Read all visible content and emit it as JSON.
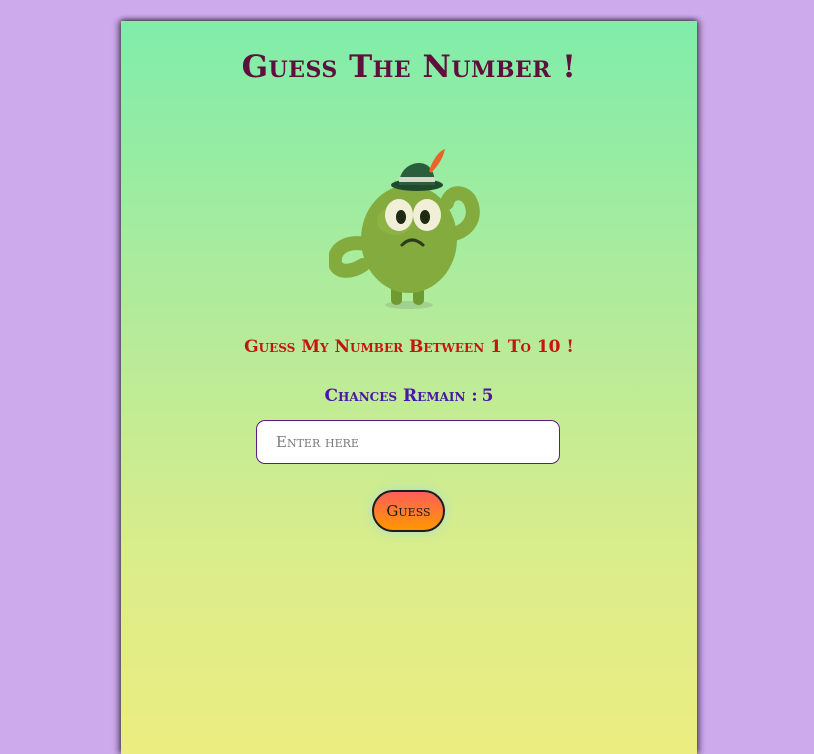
{
  "game": {
    "title": "Guess The Number !",
    "prompt": "Guess My Number Between 1 To 10 !",
    "chances_label": "Chances Remain :",
    "chances_remaining": "5",
    "input": {
      "placeholder": "Enter here",
      "value": ""
    },
    "guess_button_label": "Guess",
    "mascot_icon": "confused-green-blob-with-feathered-hat"
  },
  "colors": {
    "page_background": "#cdaaec",
    "card_gradient_top": "#7fedaa",
    "card_gradient_bottom": "#eced80",
    "title": "#5e0f3b",
    "prompt": "#c4160f",
    "chances": "#4a16a8",
    "button_gradient_top": "#ff5f5a",
    "button_gradient_bottom": "#ff9700"
  }
}
